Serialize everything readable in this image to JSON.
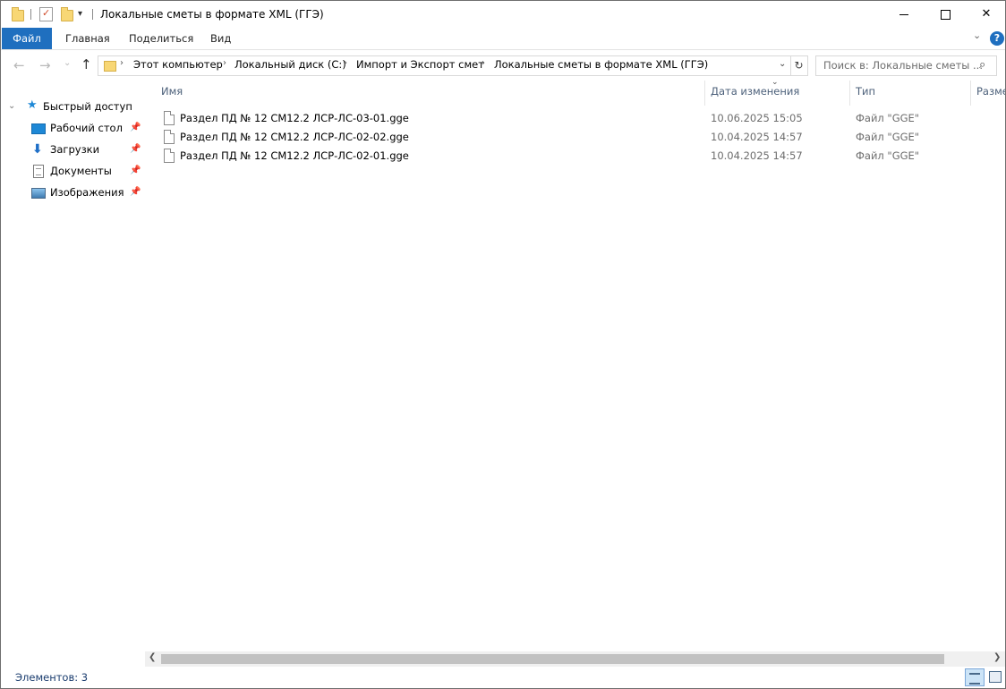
{
  "window": {
    "title": "Локальные сметы в формате XML (ГГЭ)",
    "controls": {
      "minimize": "",
      "maximize": "",
      "close": "✕"
    }
  },
  "ribbon": {
    "tabs": [
      "Файл",
      "Главная",
      "Поделиться",
      "Вид"
    ],
    "help": "?"
  },
  "address": {
    "breadcrumb": [
      "Этот компьютер",
      "Локальный диск (C:)",
      "Импорт и Экспорт смет",
      "Локальные сметы в формате XML (ГГЭ)"
    ],
    "separator": "›"
  },
  "search": {
    "placeholder": "Поиск в: Локальные сметы ..."
  },
  "navpane": {
    "quick_access": "Быстрый доступ",
    "items": [
      {
        "label": "Рабочий стол",
        "icon": "desktop-icon",
        "pinned": true
      },
      {
        "label": "Загрузки",
        "icon": "downloads-icon",
        "pinned": true
      },
      {
        "label": "Документы",
        "icon": "documents-icon",
        "pinned": true
      },
      {
        "label": "Изображения",
        "icon": "pictures-icon",
        "pinned": true
      }
    ]
  },
  "columns": [
    "Имя",
    "Дата изменения",
    "Тип",
    "Разме"
  ],
  "files": [
    {
      "name": "Раздел ПД № 12 СМ12.2 ЛСР-ЛС-03-01.gge",
      "date": "10.06.2025 15:05",
      "type": "Файл \"GGE\""
    },
    {
      "name": "Раздел ПД № 12 СМ12.2 ЛСР-ЛС-02-02.gge",
      "date": "10.04.2025 14:57",
      "type": "Файл \"GGE\""
    },
    {
      "name": "Раздел ПД № 12 СМ12.2 ЛСР-ЛС-02-01.gge",
      "date": "10.04.2025 14:57",
      "type": "Файл \"GGE\""
    }
  ],
  "status": {
    "items_count": "Элементов: 3"
  },
  "colors": {
    "accent": "#1f6fbf",
    "header_text": "#4c607a",
    "secondary_text": "#6d6d6d"
  }
}
